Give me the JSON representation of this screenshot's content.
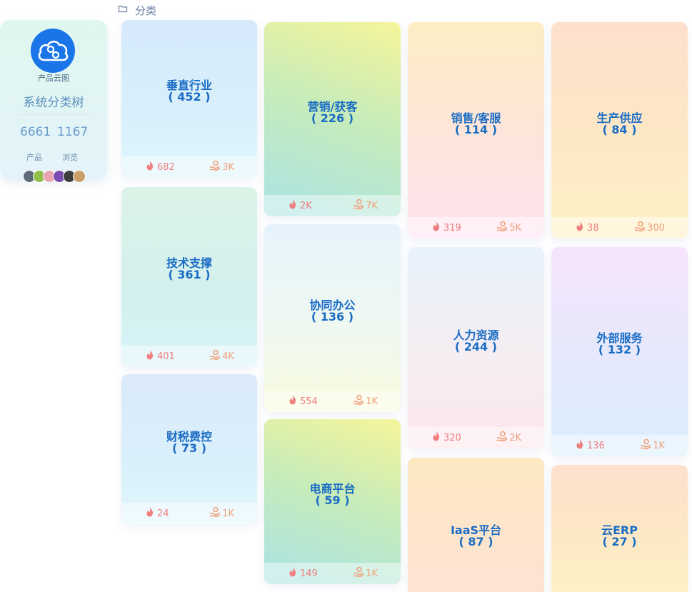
{
  "header": {
    "breadcrumb": "分类"
  },
  "profile": {
    "logo_label": "产品云图",
    "title": "系统分类树",
    "stats": [
      {
        "value": "6661",
        "label": "产品"
      },
      {
        "value": "1167",
        "label": "浏览"
      }
    ]
  },
  "categories": [
    {
      "name": "垂直行业",
      "count": "( 452 )",
      "hot": "682",
      "visits": "3K"
    },
    {
      "name": "技术支撑",
      "count": "( 361 )",
      "hot": "401",
      "visits": "4K"
    },
    {
      "name": "财税费控",
      "count": "( 73 )",
      "hot": "24",
      "visits": "1K"
    },
    {
      "name": "营销/获客",
      "count": "( 226 )",
      "hot": "2K",
      "visits": "7K"
    },
    {
      "name": "协同办公",
      "count": "( 136 )",
      "hot": "554",
      "visits": "1K"
    },
    {
      "name": "电商平台",
      "count": "( 59 )",
      "hot": "149",
      "visits": "1K"
    },
    {
      "name": "销售/客服",
      "count": "( 114 )",
      "hot": "319",
      "visits": "5K"
    },
    {
      "name": "人力资源",
      "count": "( 244 )",
      "hot": "320",
      "visits": "2K"
    },
    {
      "name": "IaaS平台",
      "count": "( 87 )"
    },
    {
      "name": "生产供应",
      "count": "( 84 )",
      "hot": "38",
      "visits": "300"
    },
    {
      "name": "外部服务",
      "count": "( 132 )",
      "hot": "136",
      "visits": "1K"
    },
    {
      "name": "云ERP",
      "count": "( 27 )"
    }
  ],
  "colors": {
    "title_blue": "#1a6cc4",
    "hot_red": "#f07e7e",
    "hand_orange": "#f0a07a",
    "logo_blue": "#1a76e8"
  },
  "icons": {
    "breadcrumb": "folder-icon",
    "hot": "fire-icon",
    "visits": "hand-heart-icon",
    "logo": "cloud-logo-icon"
  }
}
